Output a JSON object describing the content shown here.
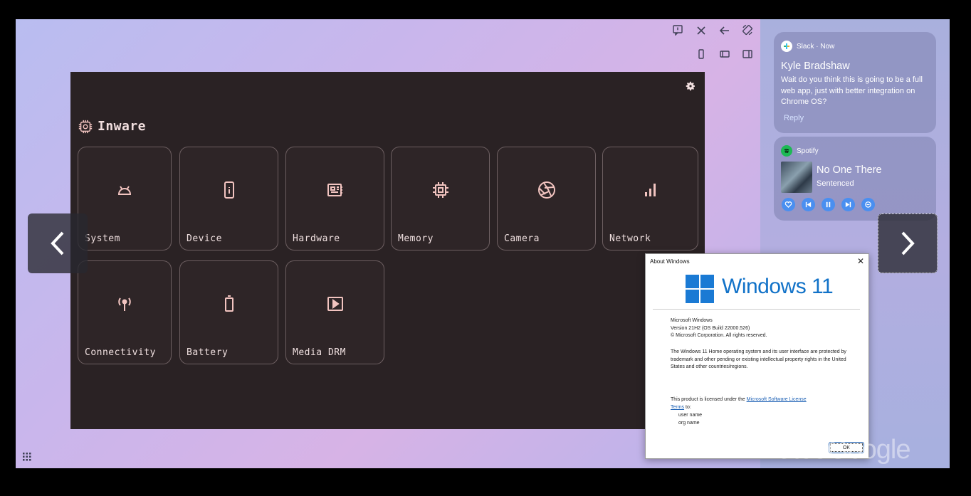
{
  "app": {
    "title": "Inware",
    "tiles": [
      {
        "label": "System",
        "icon": "android-icon"
      },
      {
        "label": "Device",
        "icon": "phone-info-icon"
      },
      {
        "label": "Hardware",
        "icon": "hardware-board-icon"
      },
      {
        "label": "Memory",
        "icon": "chip-icon"
      },
      {
        "label": "Camera",
        "icon": "camera-shutter-icon"
      },
      {
        "label": "Network",
        "icon": "signal-bars-icon"
      },
      {
        "label": "Connectivity",
        "icon": "antenna-icon"
      },
      {
        "label": "Battery",
        "icon": "battery-icon"
      },
      {
        "label": "Media DRM",
        "icon": "play-box-icon"
      }
    ]
  },
  "notifications": {
    "slack": {
      "app": "Slack · Now",
      "title": "Kyle Bradshaw",
      "body": "Wait do you think this is going to be a full web app, just with better integration on Chrome OS?",
      "reply": "Reply"
    },
    "spotify": {
      "app": "Spotify",
      "song": "No One There",
      "artist": "Sentenced"
    }
  },
  "about_dialog": {
    "title": "About Windows",
    "brand": "Windows 11",
    "line1": "Microsoft Windows",
    "line2": "Version 21H2 (OS Build 22000.526)",
    "line3": "© Microsoft Corporation. All rights reserved.",
    "legal": "The Windows 11 Home operating system and its user interface are protected by trademark and other pending or existing intellectual property rights in the United States and other countries/regions.",
    "license_prefix": "This product is licensed under the ",
    "license_link_a": "Microsoft Software License",
    "license_link_b": "Terms",
    "license_suffix": " to:",
    "user": "user name",
    "org": "org name",
    "ok": "OK"
  },
  "watermark": "9to5Google",
  "colors": {
    "app_bg": "#2a2224",
    "tile_icon": "#f2c4c0",
    "windows_blue": "#1172c8",
    "control_blue": "#4a8ff0"
  }
}
